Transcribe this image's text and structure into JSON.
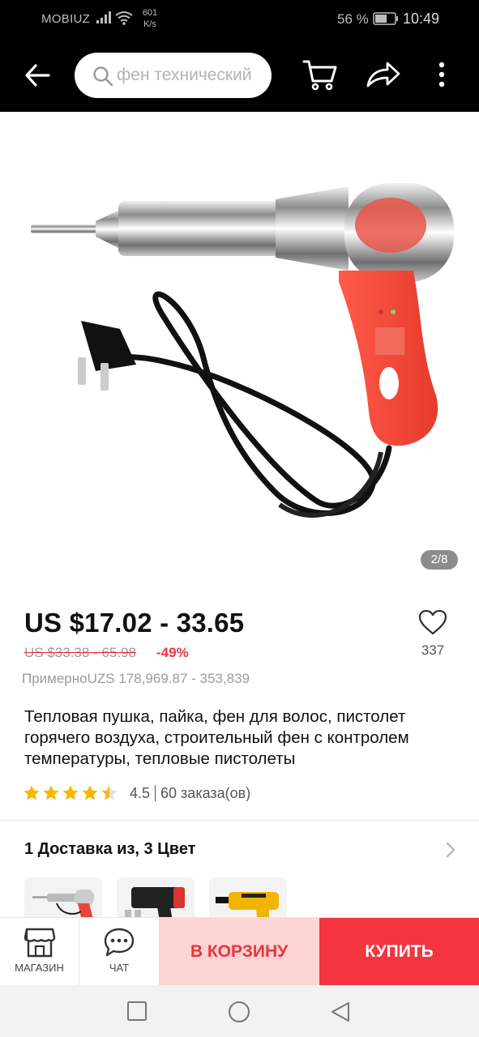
{
  "status_bar": {
    "carrier": "MOBIUZ",
    "speed_value": "601",
    "speed_unit": "K/s",
    "battery_percent": "56 %",
    "time": "10:49"
  },
  "toolbar": {
    "search_placeholder": "фен технический"
  },
  "gallery": {
    "counter": "2/8"
  },
  "product": {
    "price": "US $17.02 - 33.65",
    "old_price": "US $33.38 - 65.98",
    "discount": "-49%",
    "approx_price": "ПримерноUZS 178,969.87 - 353,839",
    "title": "Тепловая пушка, пайка, фен для волос, пистолет горячего воздуха, строительный фен с контролем температуры, тепловые пистолеты",
    "rating": "4.5",
    "rating_stars": 4.5,
    "orders": "60 заказа(ов)",
    "wishlist_count": "337"
  },
  "variants": {
    "heading": "1 Доставка из, 3 Цвет"
  },
  "action_bar": {
    "store_label": "МАГАЗИН",
    "chat_label": "ЧАТ",
    "cart_label": "В КОРЗИНУ",
    "buy_label": "КУПИТЬ"
  },
  "colors": {
    "accent_red": "#f4353f",
    "cart_bg": "#fdd4d4",
    "star_yellow": "#f5b800"
  }
}
